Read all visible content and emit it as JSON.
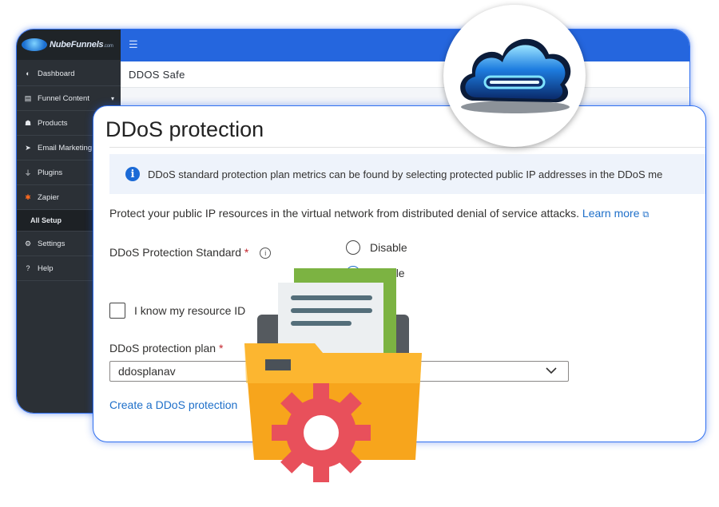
{
  "brand": {
    "name": "NubeFunnels",
    "suffix": ".com"
  },
  "sidebar": {
    "items": [
      {
        "label": "Dashboard",
        "icon": "dashboard-icon"
      },
      {
        "label": "Funnel Content",
        "icon": "document-icon",
        "caret": "▾"
      },
      {
        "label": "Products",
        "icon": "products-icon"
      },
      {
        "label": "Email Marketing",
        "icon": "send-icon"
      },
      {
        "label": "Plugins",
        "icon": "plug-icon"
      },
      {
        "label": "Zapier",
        "icon": "zapier-icon"
      },
      {
        "label": "All Setup",
        "icon": ""
      },
      {
        "label": "Settings",
        "icon": "gear-icon"
      },
      {
        "label": "Help",
        "icon": "help-icon"
      }
    ]
  },
  "topbar": {
    "menu_icon": "hamburger-icon"
  },
  "breadcrumb": {
    "title": "DDOS Safe"
  },
  "panel": {
    "title": "DDoS protection",
    "info": "DDoS standard protection plan metrics can be found by selecting protected public IP addresses in the DDoS me",
    "protect_text": "Protect your public IP resources in the virtual network from distributed denial of service attacks.",
    "learn_more": "Learn more",
    "standard_label": "DDoS Protection Standard",
    "required_mark": "*",
    "info_icon": "i",
    "radio_disable": "Disable",
    "radio_enable": "Enable",
    "checkbox_label": "I know my resource ID",
    "plan_label": "DDoS protection plan",
    "plan_value": "ddosplanav",
    "create_link": "Create a DDoS protection"
  },
  "colors": {
    "accent": "#2566de",
    "sidebar": "#2b3036",
    "link": "#1e6fc9",
    "required": "#c4262e",
    "folder": "#f7a51c",
    "gear": "#e8505b"
  }
}
